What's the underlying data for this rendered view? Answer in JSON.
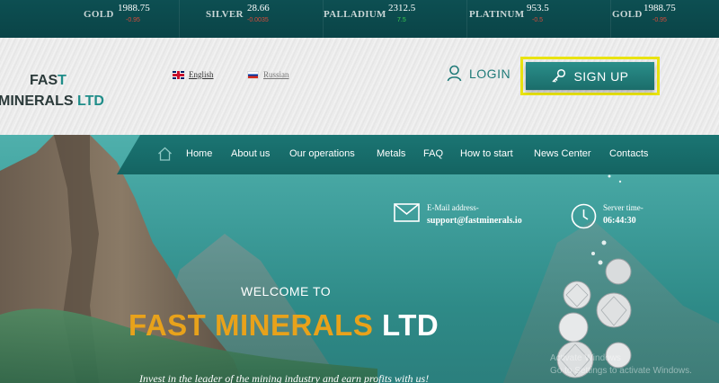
{
  "ticker": [
    {
      "name": "GOLD",
      "price": "1988.75",
      "change": "-0.95",
      "direction": "neg"
    },
    {
      "name": "SILVER",
      "price": "28.66",
      "change": "-0.0035",
      "direction": "neg"
    },
    {
      "name": "PALLADIUM",
      "price": "2312.5",
      "change": "7.5",
      "direction": "pos"
    },
    {
      "name": "PLATINUM",
      "price": "953.5",
      "change": "-0.5",
      "direction": "neg"
    },
    {
      "name": "GOLD",
      "price": "1988.75",
      "change": "-0.95",
      "direction": "neg"
    }
  ],
  "logo": {
    "line1_main": "FAS",
    "line1_accent": "T",
    "line2_main": "MINERALS ",
    "line2_accent": "LTD"
  },
  "languages": [
    {
      "label": "English",
      "flag": "uk-flag-icon"
    },
    {
      "label": "Russian",
      "flag": "ru-flag-icon"
    }
  ],
  "auth": {
    "login_label": "LOGIN",
    "signup_label": "SIGN UP"
  },
  "nav": {
    "items": [
      "Home",
      "About us",
      "Our operations",
      "Metals",
      "FAQ",
      "How to start",
      "News Center",
      "Contacts"
    ]
  },
  "contact": {
    "email_label": "E-Mail address-",
    "email_value": "support@fastminerals.io",
    "time_label": "Server time-",
    "time_value": "06:44:30"
  },
  "hero": {
    "welcome": "WELCOME TO",
    "brand_main": "FAST MINERALS",
    "brand_accent": " LTD",
    "tagline": "Invest in the leader of the mining industry and earn profits with us!"
  },
  "watermark": {
    "line1": "Activate Windows",
    "line2": "Go to Settings to activate Windows."
  },
  "colors": {
    "accent": "#1f8d89",
    "brand_gold": "#e8a21b",
    "highlight": "#e9e311",
    "nav_bg": "#1b7573"
  }
}
